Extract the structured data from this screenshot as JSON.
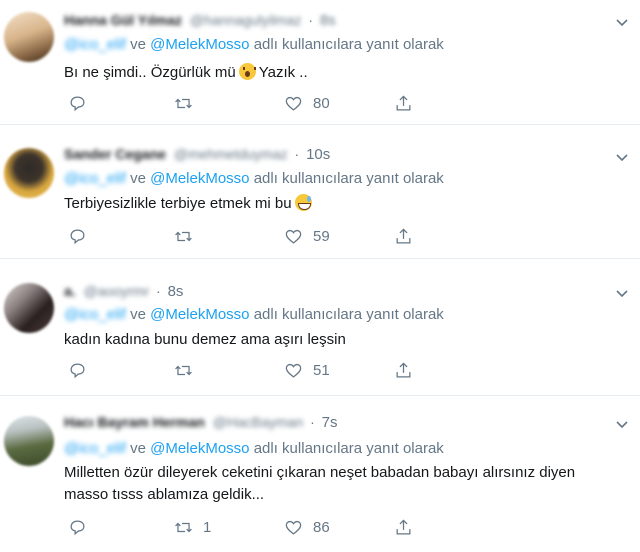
{
  "tweets": [
    {
      "name": "Hanna Gül Yılmaz",
      "handle": "@hannagulyilmaz",
      "time": "8s",
      "reply_user": "@ico_elif",
      "reply_joiner": "ve",
      "reply_mention": "@MelekMosso",
      "reply_suffix": "adlı kullanıcılara yanıt olarak",
      "text_before_emoji": "Bı ne şimdi.. Özgürlük mü",
      "emoji": "astonished-face",
      "text_after_emoji": "Yazık ..",
      "reply_count": "",
      "retweet_count": "",
      "like_count": "80"
    },
    {
      "name": "Sander Cegane",
      "handle": "@mehmetduymaz",
      "time": "10s",
      "reply_user": "@ico_elif",
      "reply_joiner": "ve",
      "reply_mention": "@MelekMosso",
      "reply_suffix": "adlı kullanıcılara yanıt olarak",
      "text_before_emoji": "Terbiyesizlikle terbiye etmek mi bu",
      "emoji": "grinning-sweat-face",
      "reply_count": "",
      "retweet_count": "",
      "like_count": "59"
    },
    {
      "name": "a.",
      "handle": "@aooyrmr",
      "time": "8s",
      "reply_user": "@ico_elif",
      "reply_joiner": "ve",
      "reply_mention": "@MelekMosso",
      "reply_suffix": "adlı kullanıcılara yanıt olarak",
      "text": "kadın kadına bunu demez ama aşırı leşsin",
      "reply_count": "",
      "retweet_count": "",
      "like_count": "51"
    },
    {
      "name": "Hacı Bayram Herman",
      "handle": "@HacBayman",
      "time": "7s",
      "reply_user": "@ico_elif",
      "reply_joiner": "ve",
      "reply_mention": "@MelekMosso",
      "reply_suffix": "adlı kullanıcılara yanıt olarak",
      "text_line1": "Milletten özür dileyerek ceketini çıkaran neşet babadan babayı alırsınız diyen",
      "text_line2": "masso tısss ablamıza geldik...",
      "reply_count": "",
      "retweet_count": "1",
      "like_count": "86"
    }
  ],
  "colors": {
    "accent": "#1da1f2",
    "secondary_text": "#657786",
    "primary_text": "#14171a",
    "divider": "#e6ecf0"
  },
  "icons": {
    "reply": "reply-icon",
    "retweet": "retweet-icon",
    "like": "heart-icon",
    "share": "share-icon",
    "menu": "chevron-down-icon"
  }
}
